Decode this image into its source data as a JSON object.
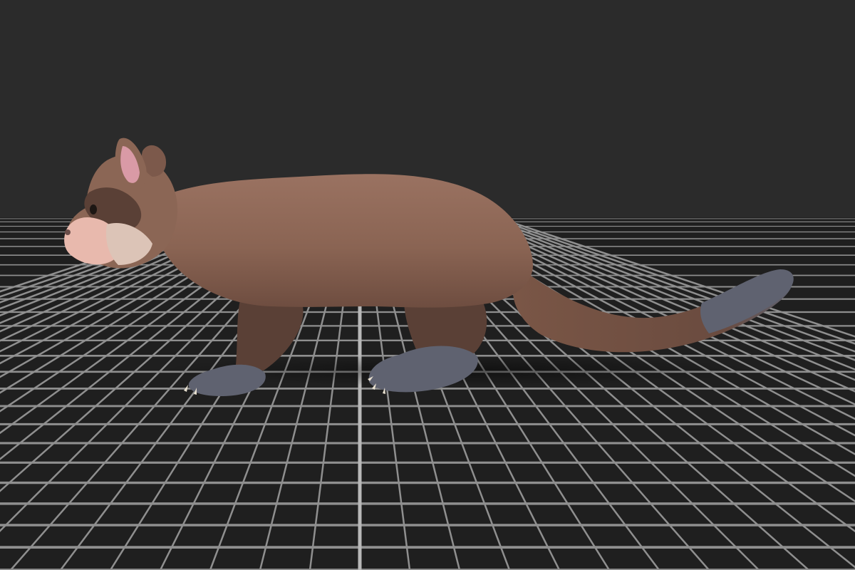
{
  "viewport": {
    "background_color": "#2b2b2b",
    "floor_color": "#1f1f1f",
    "grid_color": "#8f8f8f",
    "grid_axis_color": "#b8b8b8"
  },
  "model": {
    "subject": "ferret",
    "body_color": "#8b6655",
    "dark_fur_color": "#5a4036",
    "paw_color": "#5f6270",
    "ear_inner_color": "#d99aa6",
    "muzzle_color": "#e8b9ad"
  }
}
